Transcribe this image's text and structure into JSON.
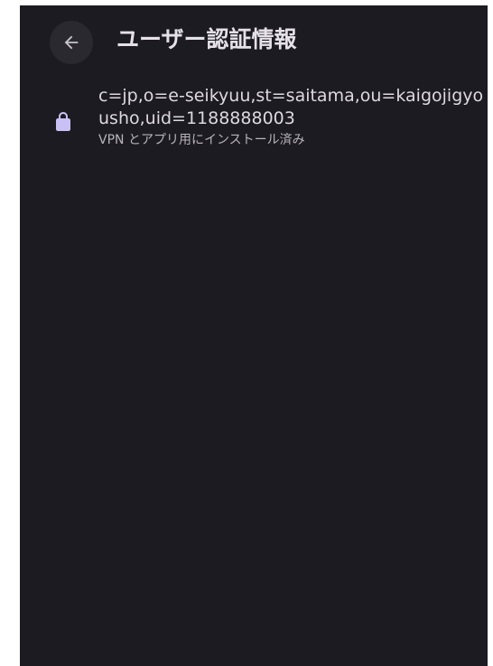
{
  "header": {
    "title": "ユーザー認証情報",
    "back_icon": "arrow-back-icon"
  },
  "credentials": [
    {
      "name": "c=jp,o=e-seikyuu,st=saitama,ou=kaigojigyousho,uid=1188888003",
      "summary": "VPN とアプリ用にインストール済み",
      "icon": "lock-icon"
    }
  ],
  "colors": {
    "background": "#1c1b21",
    "title_text": "#e6e1e9",
    "primary_text": "#ddd8e1",
    "secondary_text": "#b8b3bd",
    "lock_icon": "#c9c0f5",
    "back_button_bg": "#2a2930"
  }
}
